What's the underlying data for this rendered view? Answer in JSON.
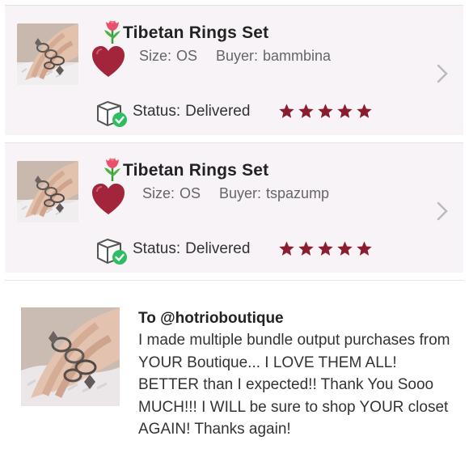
{
  "colors": {
    "star": "#8a1c2e",
    "heart": "#a3253b",
    "check": "#2ebd62",
    "card_bg": "#f7f3f6",
    "chevron": "#b9b9b9"
  },
  "orders": [
    {
      "title": "Tibetan Rings Set",
      "size_label": "Size:",
      "size_value": "OS",
      "buyer_label": "Buyer:",
      "buyer_value": "bammbina",
      "status_label": "Status:",
      "status_value": "Delivered",
      "rating": 5,
      "icons": [
        "rings-thumbnail",
        "tulip-icon",
        "heart-icon",
        "shipping-box-check-icon",
        "chevron-right-icon"
      ]
    },
    {
      "title": "Tibetan Rings Set",
      "size_label": "Size:",
      "size_value": "OS",
      "buyer_label": "Buyer:",
      "buyer_value": "tspazump",
      "status_label": "Status:",
      "status_value": "Delivered",
      "rating": 5,
      "icons": [
        "rings-thumbnail",
        "tulip-icon",
        "heart-icon",
        "shipping-box-check-icon",
        "chevron-right-icon"
      ]
    }
  ],
  "review": {
    "to": "To @hotrioboutique",
    "text": "I made multiple bundle output purchases from YOUR Boutique... I LOVE THEM ALL! BETTER than I expected!! Thank You Sooo MUCH!!! I WILL be sure to shop YOUR closet AGAIN! Thanks again!"
  }
}
